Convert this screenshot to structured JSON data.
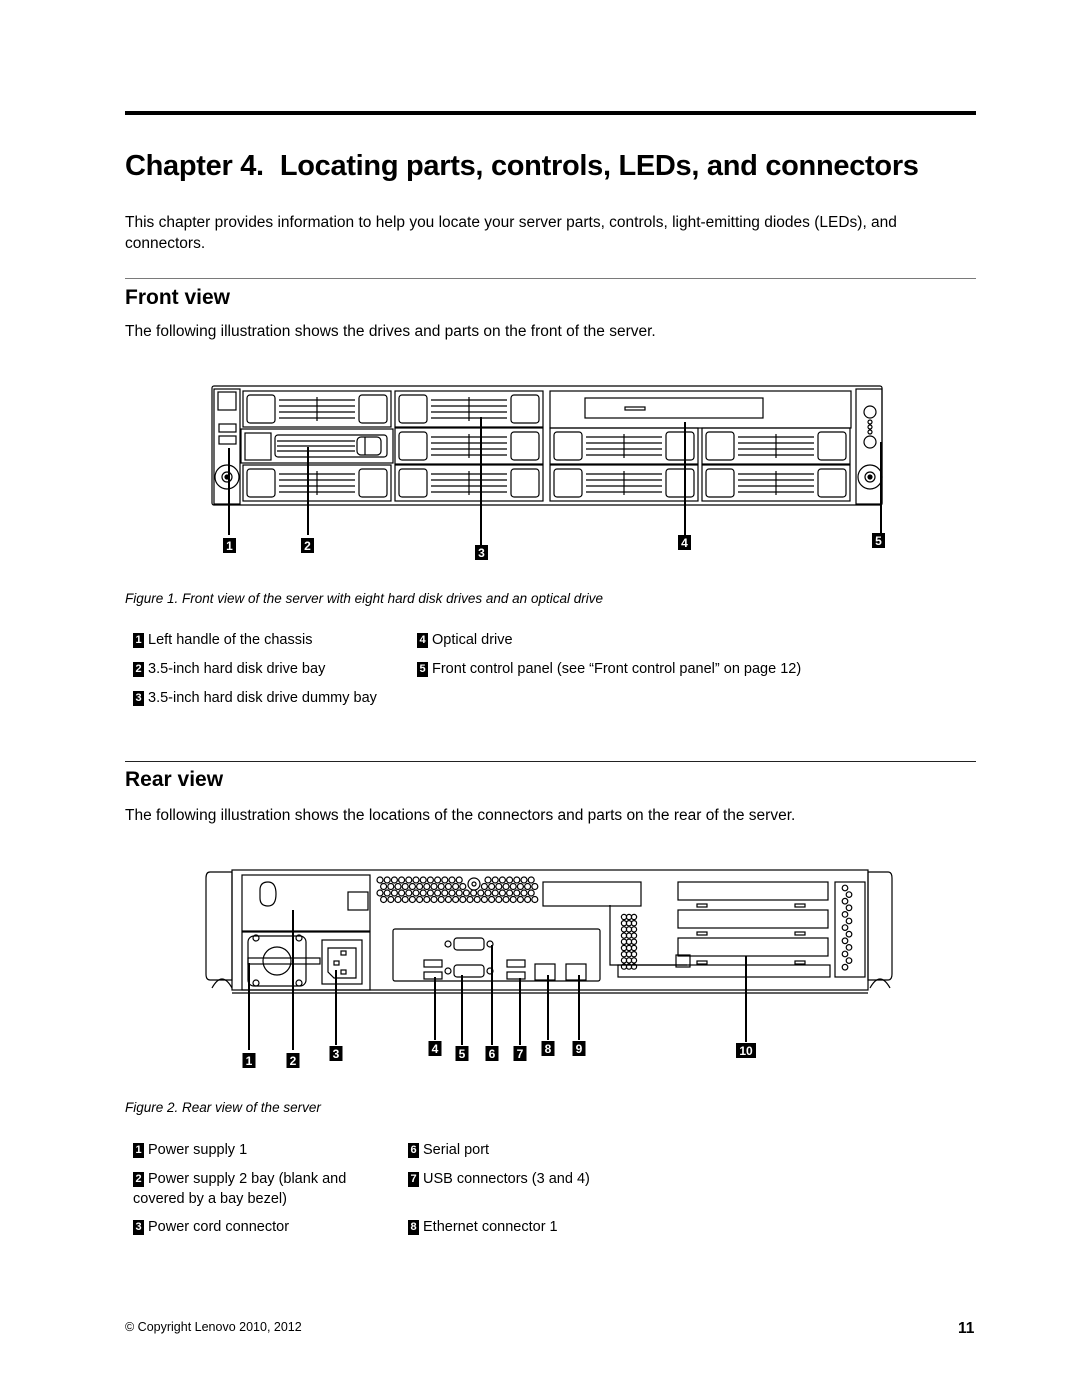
{
  "chapter": {
    "number": "Chapter 4.",
    "title": "Locating parts, controls, LEDs, and connectors",
    "intro": "This chapter provides information to help you locate your server parts, controls, light-emitting diodes (LEDs), and connectors."
  },
  "front_view": {
    "heading": "Front view",
    "description": "The following illustration shows the drives and parts on the front of the server.",
    "figure_caption": "Figure 1.  Front view of the server with eight hard disk drives and an optical drive",
    "callouts": [
      "1",
      "2",
      "3",
      "4",
      "5"
    ],
    "legend": [
      {
        "num": "1",
        "label": "Left handle of the chassis"
      },
      {
        "num": "2",
        "label": "3.5-inch hard disk drive bay"
      },
      {
        "num": "3",
        "label": "3.5-inch hard disk drive dummy bay"
      },
      {
        "num": "4",
        "label": "Optical drive"
      },
      {
        "num": "5",
        "label": "Front control panel (see “Front control panel” on page 12)"
      }
    ]
  },
  "rear_view": {
    "heading": "Rear view",
    "description": "The following illustration shows the locations of the connectors and parts on the rear of the server.",
    "figure_caption": "Figure 2.  Rear view of the server",
    "callouts": [
      "1",
      "2",
      "3",
      "4",
      "5",
      "6",
      "7",
      "8",
      "9",
      "10"
    ],
    "legend": [
      {
        "num": "1",
        "label": "Power supply 1"
      },
      {
        "num": "2",
        "label": "Power supply 2 bay (blank and covered by a bay bezel)"
      },
      {
        "num": "3",
        "label": "Power cord connector"
      },
      {
        "num": "6",
        "label": "Serial port"
      },
      {
        "num": "7",
        "label": "USB connectors (3 and 4)"
      },
      {
        "num": "8",
        "label": "Ethernet connector 1"
      }
    ]
  },
  "footer": {
    "copyright": "© Copyright Lenovo 2010, 2012",
    "page_number": "11"
  }
}
